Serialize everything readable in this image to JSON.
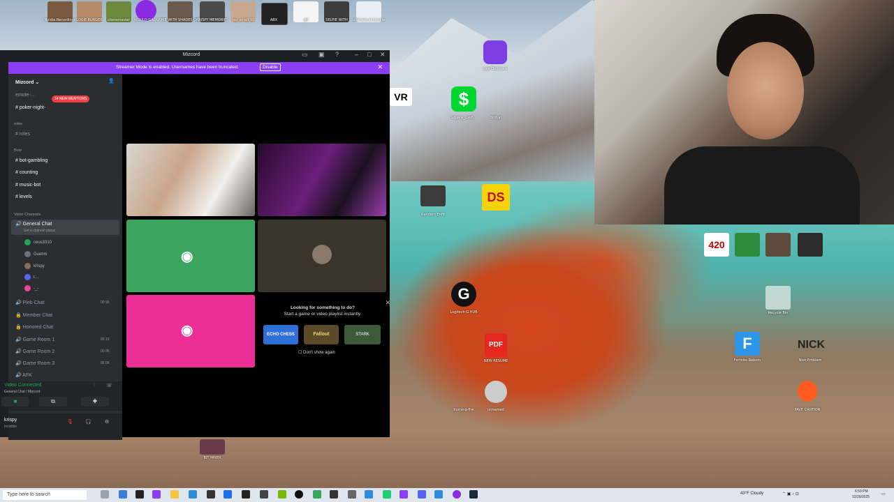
{
  "discord": {
    "window_title": "Mizcord",
    "streamer_banner": "Streamer Mode is enabled. Usernames have been truncated.",
    "disable_label": "Disable",
    "server_name": "Mizcord",
    "mentions_badge": "14 NEW MENTIONS",
    "channels_top": [
      "emote-…",
      "poker-night-"
    ],
    "category_roles": "roles",
    "roles_channel": "roles",
    "category_bots": "Bots",
    "bot_channels": [
      "bot-gambling",
      "counting",
      "music-bot",
      "levels"
    ],
    "category_voice": "Voice Channels",
    "voice_general": "General Chat",
    "voice_general_sub": "Set a channel status",
    "members": [
      "ceus3310",
      "Guenni",
      "krispy",
      "t…",
      "-_-"
    ],
    "voice_channels": [
      {
        "name": "Pleb Chat",
        "count": "00 99"
      },
      {
        "name": "Member Chat",
        "count": ""
      },
      {
        "name": "Honored Chat",
        "count": ""
      },
      {
        "name": "Game Room 1",
        "count": "00 10"
      },
      {
        "name": "Game Room 2",
        "count": "00 06"
      },
      {
        "name": "Game Room 3",
        "count": "00 06"
      },
      {
        "name": "AFK",
        "count": ""
      }
    ],
    "video_connected": "Video Connected",
    "video_connected_sub": "General Chat / Mizcord",
    "username": "krispy",
    "user_status": "Invisible",
    "promo_title": "Looking for something to do?",
    "promo_sub": "Start a game or video playlist instantly.",
    "dont_show": "Don't show again",
    "promo_games": [
      "ECHO CHESS",
      "Fallout",
      "STARK"
    ]
  },
  "desktop_icons": [
    {
      "label": "Nvidia Recordings"
    },
    {
      "label": "LOUIE BURGER"
    },
    {
      "label": "chessmaster"
    },
    {
      "label": "WOULD GALAXY"
    },
    {
      "label": "ME WITH SHADES ON"
    },
    {
      "label": "KRISPY MEMORIES"
    },
    {
      "label": "ico_small_dl"
    },
    {
      "label": "ABX"
    },
    {
      "label": "gif"
    },
    {
      "label": "SELFIE WITH"
    },
    {
      "label": "KRISPY (JUNKIE)"
    },
    {
      "label": "ultimate-ai-bundle"
    },
    {
      "label": "Logi Options+"
    },
    {
      "label": "VR"
    },
    {
      "label": "Square_Cash..."
    },
    {
      "label": "bird.ai"
    },
    {
      "label": "Random Enfit"
    },
    {
      "label": "DS"
    },
    {
      "label": "Logitech G HUB"
    },
    {
      "label": "NEW RESUME"
    },
    {
      "label": "unnamed"
    },
    {
      "label": "burning-fire"
    },
    {
      "label": "Fortnite Reborn"
    },
    {
      "label": "Nick Emblem"
    },
    {
      "label": "Recycle Bin"
    },
    {
      "label": "PAVE CAUTION"
    },
    {
      "label": "BIT PAYER"
    }
  ],
  "taskbar": {
    "search_placeholder": "Type here to search",
    "weather": "43°F Cloudy",
    "time": "6:59 PM",
    "date": "12/20/2025"
  }
}
